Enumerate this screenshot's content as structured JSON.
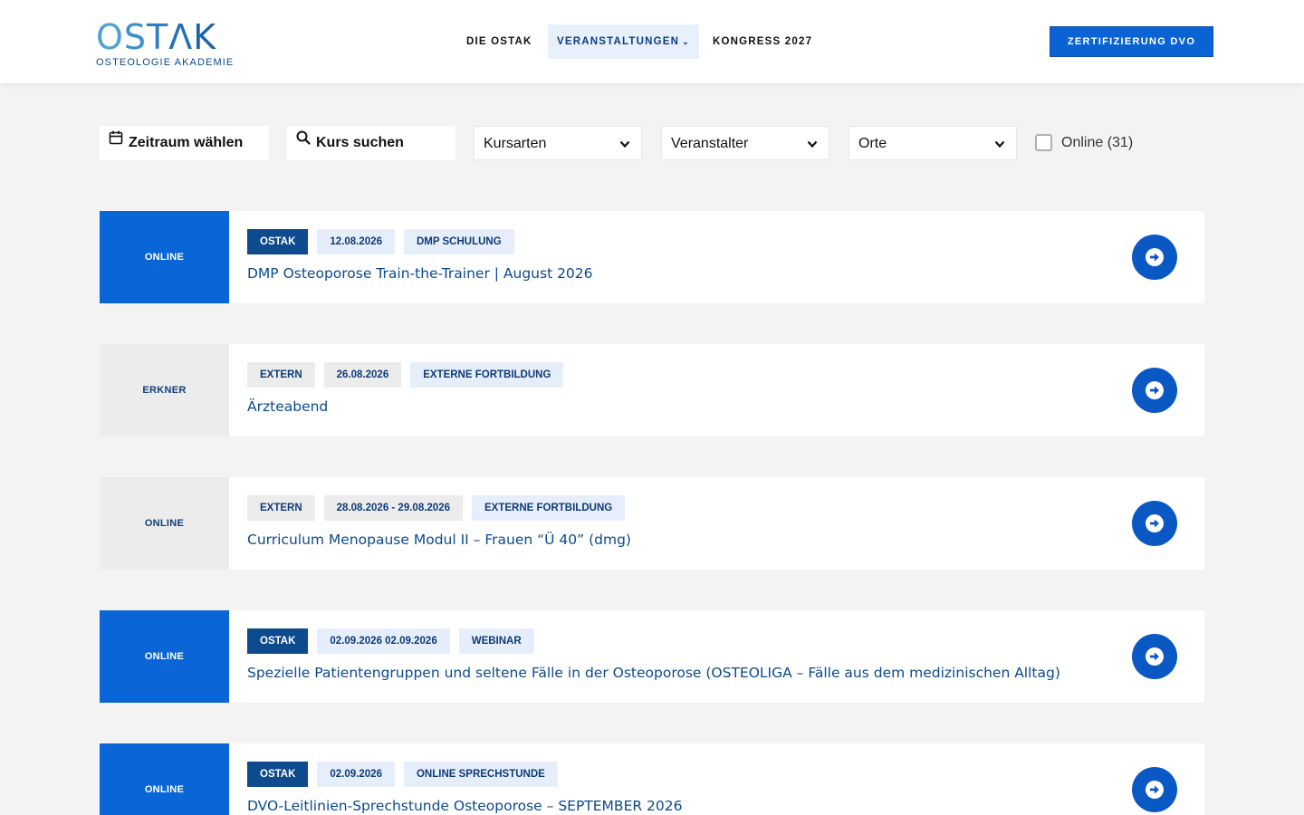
{
  "header": {
    "logo_text": "OSTAK",
    "logo_subtitle": "OSTEOLOGIE AKADEMIE",
    "nav": [
      {
        "label": "DIE OSTAK"
      },
      {
        "label": "VERANSTALTUNGEN"
      },
      {
        "label": "KONGRESS 2027"
      }
    ],
    "cta_label": "ZERTIFIZIERUNG DVO"
  },
  "filters": {
    "date_label": "Zeitraum wählen",
    "search_label": "Kurs suchen",
    "course_types": "Kursarten",
    "organizer": "Veranstalter",
    "places": "Orte",
    "online_label": "Online (31)"
  },
  "events": [
    {
      "location": "ONLINE",
      "tags": [
        "OSTAK",
        "12.08.2026",
        "DMP SCHULUNG"
      ],
      "title": "DMP Osteoporose Train-the-Trainer | August 2026"
    },
    {
      "location": "ERKNER",
      "tags": [
        "EXTERN",
        "26.08.2026",
        "EXTERNE FORTBILDUNG"
      ],
      "title": "Ärzteabend"
    },
    {
      "location": "ONLINE",
      "tags": [
        "EXTERN",
        "28.08.2026 - 29.08.2026",
        "EXTERNE FORTBILDUNG"
      ],
      "title": "Curriculum Menopause Modul II – Frauen “Ü 40” (dmg)"
    },
    {
      "location": "ONLINE",
      "tags": [
        "OSTAK",
        "02.09.2026 02.09.2026",
        "WEBINAR"
      ],
      "title": "Spezielle Patientengruppen und seltene Fälle in der Osteoporose (OSTEOLIGA – Fälle aus dem medizinischen Alltag)"
    },
    {
      "location": "ONLINE",
      "tags": [
        "OSTAK",
        "02.09.2026",
        "ONLINE SPRECHSTUNDE"
      ],
      "title": "DVO-Leitlinien-Sprechstunde Osteoporose – SEPTEMBER 2026"
    }
  ],
  "colors": {
    "primary": "#0a66d6",
    "dark_tag": "#0d4a8e",
    "title": "#0b4a8f",
    "background": "#f3f3f3"
  }
}
